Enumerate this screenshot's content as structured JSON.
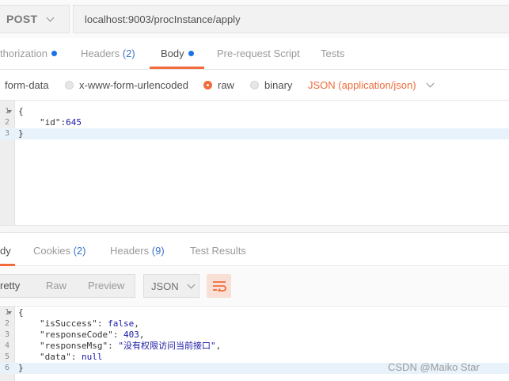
{
  "request": {
    "method": "POST",
    "url": "localhost:9003/procInstance/apply"
  },
  "request_tabs": [
    {
      "label": "thorization",
      "count": "",
      "dot": true
    },
    {
      "label": "Headers",
      "count": "(2)",
      "dot": false
    },
    {
      "label": "Body",
      "count": "",
      "dot": true
    },
    {
      "label": "Pre-request Script",
      "count": "",
      "dot": false
    },
    {
      "label": "Tests",
      "count": "",
      "dot": false
    }
  ],
  "body_options": {
    "form_data": "form-data",
    "urlencoded": "x-www-form-urlencoded",
    "raw": "raw",
    "binary": "binary",
    "selected": "raw",
    "content_type": "JSON (application/json)"
  },
  "request_body": {
    "line_numbers": [
      "1",
      "2",
      "3"
    ],
    "open_brace": "{",
    "id_key": "\"id\"",
    "id_value": "645",
    "close_brace": "}"
  },
  "response_tabs": [
    {
      "label": "dy",
      "count": ""
    },
    {
      "label": "Cookies",
      "count": "(2)"
    },
    {
      "label": "Headers",
      "count": "(9)"
    },
    {
      "label": "Test Results",
      "count": ""
    }
  ],
  "response_view": {
    "modes": [
      "retty",
      "Raw",
      "Preview"
    ],
    "active_mode": "retty",
    "format": "JSON"
  },
  "response_body": {
    "line_numbers": [
      "1",
      "2",
      "3",
      "4",
      "5",
      "6"
    ],
    "open_brace": "{",
    "close_brace": "}",
    "fields": [
      {
        "key": "\"isSuccess\"",
        "value": "false",
        "comma": ","
      },
      {
        "key": "\"responseCode\"",
        "value": "403",
        "comma": ","
      },
      {
        "key": "\"responseMsg\"",
        "value": "\"没有权限访问当前接口\"",
        "comma": ","
      },
      {
        "key": "\"data\"",
        "value": "null",
        "comma": ""
      }
    ]
  },
  "watermark": "CSDN @Maiko Star",
  "colors": {
    "accent": "#f26b3a",
    "dot_blue": "#1b72e8",
    "count_blue": "#3b74c8",
    "code_value": "#1a1aa6"
  },
  "icons": {
    "method_dropdown": "chevron-down-icon",
    "wrap_lines": "wrap-lines-icon"
  }
}
